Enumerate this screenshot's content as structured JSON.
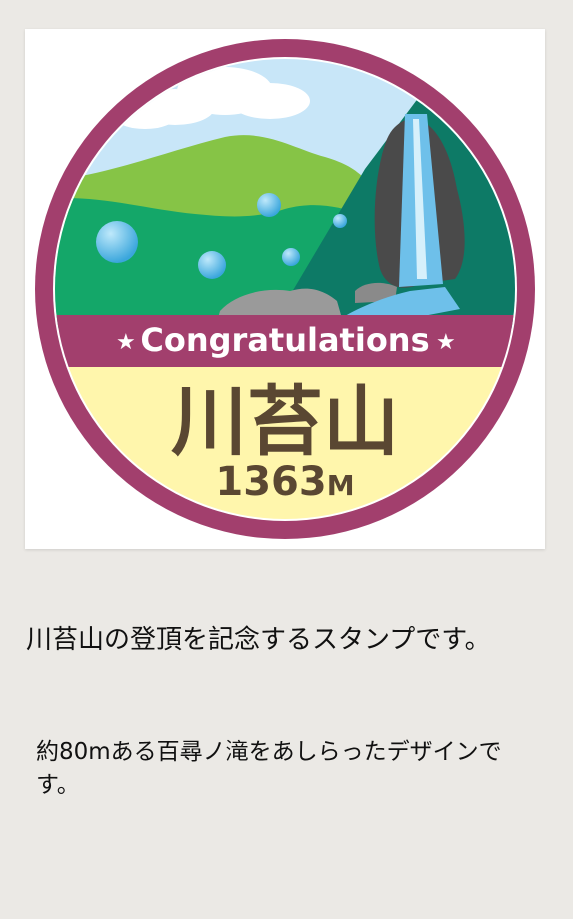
{
  "stamp": {
    "banner_text": "Congratulations",
    "mountain_name": "川苔山",
    "elevation": "1363",
    "elevation_unit": "M",
    "colors": {
      "ring": "#a23f6d",
      "banner": "#a23f6d",
      "lower_panel": "#fff6ac",
      "text": "#5a4732",
      "sky": "#c8e6f8",
      "mountain": "#86c446",
      "forest": "#14a769",
      "cliff": "#0d7a66",
      "waterfall": "#6ec0ea"
    }
  },
  "content": {
    "title": "川苔山の登頂を記念するスタンプです。",
    "description": "約80mある百尋ノ滝をあしらったデザインです。"
  }
}
